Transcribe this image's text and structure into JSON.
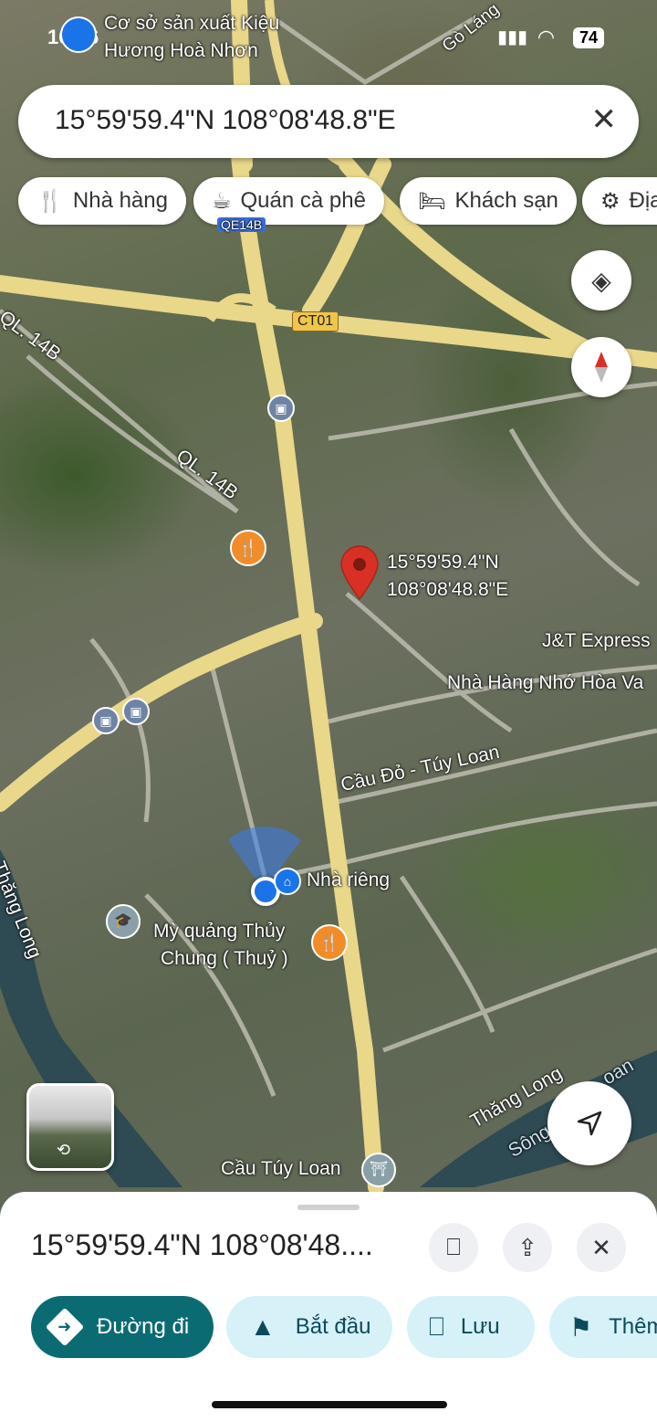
{
  "status_bar": {
    "time": "10:56",
    "battery": "74"
  },
  "search": {
    "query": "15°59'59.4\"N 108°08'48.8\"E",
    "clear_icon": "close-icon"
  },
  "chips": [
    {
      "label": "Nhà hàng",
      "icon": "restaurant-icon"
    },
    {
      "label": "Quán cà phê",
      "icon": "cafe-icon"
    },
    {
      "label": "Khách sạn",
      "icon": "hotel-icon"
    },
    {
      "label": "Địa",
      "icon": "attraction-icon"
    }
  ],
  "map": {
    "road_labels": {
      "ql14b_top": "QL. 14B",
      "ql14b": "QL. 14B",
      "ct01": "CT01",
      "qe14b": "QE14B",
      "go_lang": "Gò Láng",
      "cau_do_tuy_loan": "Cầu Đỏ - Túy Loan",
      "thang_long_left": "Thăng Long",
      "thang_long_right": "Thăng Long",
      "song": "Sông",
      "loan": "oan"
    },
    "places": {
      "top_poi_line1": "Cơ sở sản xuất Kiệu",
      "top_poi_line2": "Hương Hoà Nhơn",
      "jt_express": "J&T Express",
      "nha_hang": "Nhà Hàng Nhớ Hòa Va",
      "nha_rieng": "Nhà riêng",
      "my_quang_line1": "Mỳ quảng Thủy",
      "my_quang_line2": "Chung ( Thuỷ )",
      "cau_tuy_loan": "Cầu Túy Loan"
    },
    "pin": {
      "lat": "15°59'59.4\"N",
      "lng": "108°08'48.8\"E"
    }
  },
  "sheet": {
    "title": "15°59'59.4\"N 108°08'48....",
    "actions": [
      {
        "label": "Đường đi",
        "icon": "directions-icon",
        "style": "primary"
      },
      {
        "label": "Bắt đầu",
        "icon": "navigation-icon",
        "style": "secondary"
      },
      {
        "label": "Lưu",
        "icon": "bookmark-icon",
        "style": "secondary"
      },
      {
        "label": "Thêm",
        "icon": "flag-icon",
        "style": "secondary"
      }
    ]
  },
  "colors": {
    "road": "#e9d78a",
    "primary_action": "#0b6b73",
    "secondary_action": "#d6f1f8",
    "pin": "#d93025",
    "location_dot": "#1a73e8"
  }
}
